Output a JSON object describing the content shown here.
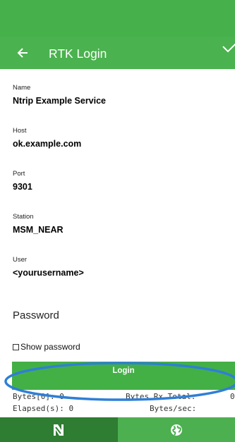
{
  "colors": {
    "status_bar": "#46b14a",
    "app_bar": "#4ab24e",
    "accent": "#43b046",
    "annotation": "#2f7fd6"
  },
  "app_bar": {
    "title": "RTK Login",
    "back_icon": "arrow-left-icon",
    "confirm_icon": "check-icon"
  },
  "fields": [
    {
      "label": "Name",
      "value": "Ntrip Example Service"
    },
    {
      "label": "Host",
      "value": "ok.example.com"
    },
    {
      "label": "Port",
      "value": "9301"
    },
    {
      "label": "Station",
      "value": "MSM_NEAR"
    },
    {
      "label": "User",
      "value": "<yourusername>"
    }
  ],
  "password": {
    "placeholder": "Password",
    "show_label": "Show password",
    "show_checked": false
  },
  "login_button": {
    "label": "Login"
  },
  "stats": {
    "bytes0": "Bytes[0]: 0",
    "bytes_rx_total": "Bytes Rx Total:",
    "bytes_rx_total_value": "0",
    "elapsed": "Elapsed(s): 0",
    "bytes_per_sec": "Bytes/sec:"
  },
  "bottom_nav": {
    "tabs": [
      {
        "icon": "app-logo-icon",
        "active": true
      },
      {
        "icon": "globe-icon",
        "active": false
      }
    ]
  }
}
